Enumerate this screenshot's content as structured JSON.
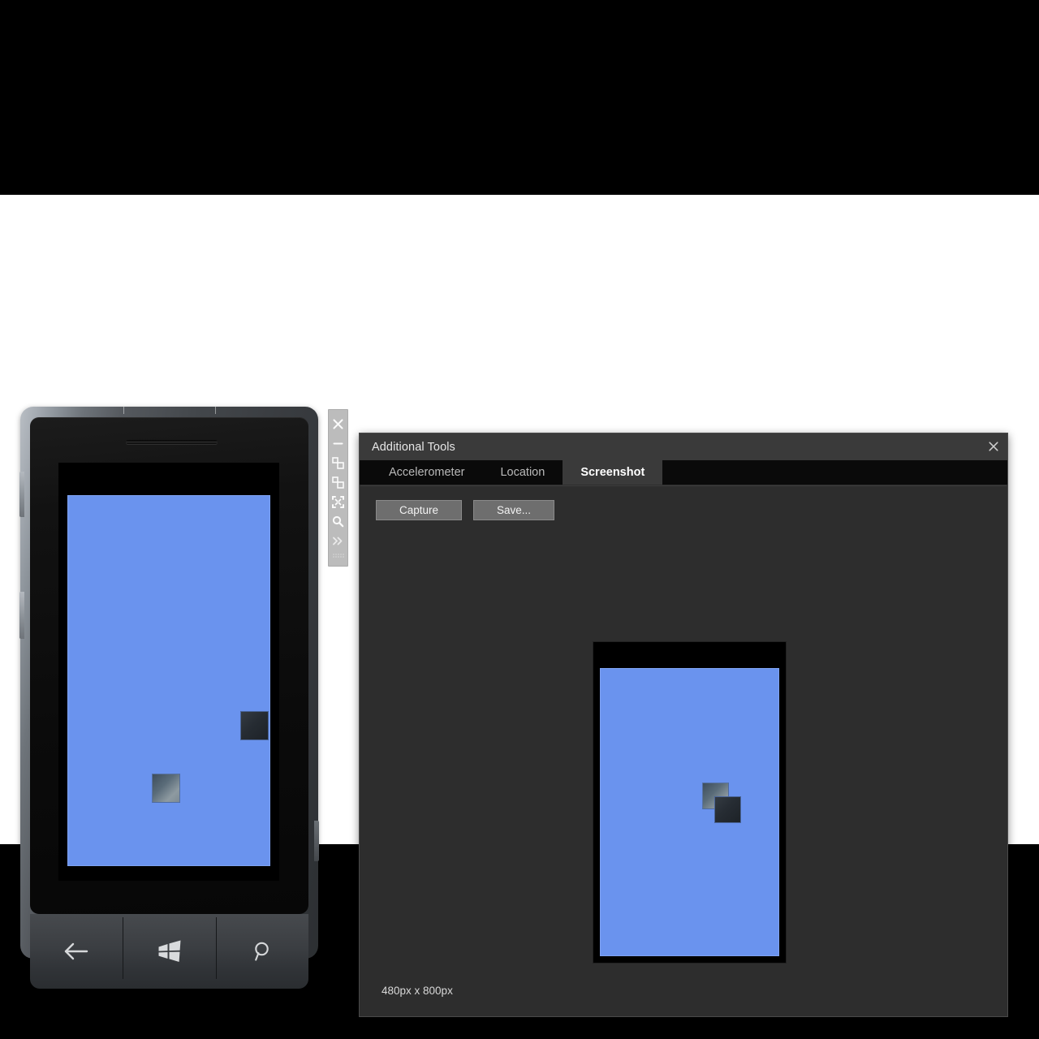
{
  "emulator": {
    "name": "windows-phone-emulator",
    "app_background_color": "#6a93ee",
    "hardware_buttons": [
      {
        "name": "back-button",
        "glyph": "←"
      },
      {
        "name": "start-button",
        "glyph": "windows-logo"
      },
      {
        "name": "search-button",
        "glyph": "⌕"
      }
    ],
    "squares": [
      {
        "name": "square-dark",
        "style": "dark"
      },
      {
        "name": "square-light",
        "style": "light"
      }
    ]
  },
  "float_toolbar": {
    "buttons": [
      {
        "name": "close-icon",
        "label": "✕"
      },
      {
        "name": "minimize-icon",
        "label": "—"
      },
      {
        "name": "rotate-left-icon",
        "label": "rotate-left"
      },
      {
        "name": "rotate-right-icon",
        "label": "rotate-right"
      },
      {
        "name": "fit-to-screen-icon",
        "label": "fit-to-screen"
      },
      {
        "name": "zoom-icon",
        "label": "zoom"
      },
      {
        "name": "expand-icon",
        "label": "»"
      }
    ]
  },
  "tools_window": {
    "title": "Additional Tools",
    "close_label": "✕",
    "tabs": [
      {
        "label": "Accelerometer",
        "active": false
      },
      {
        "label": "Location",
        "active": false
      },
      {
        "label": "Screenshot",
        "active": true
      }
    ],
    "screenshot_tab": {
      "capture_label": "Capture",
      "save_label": "Save...",
      "size_label": "480px x 800px",
      "preview_background_color": "#6a93ee"
    }
  },
  "colors": {
    "window_background": "#2d2d2d",
    "title_bar": "#3a3a3a",
    "tab_strip": "#0a0a0a",
    "accent_blue": "#6a93ee",
    "button_face": "#6e6e6e"
  }
}
